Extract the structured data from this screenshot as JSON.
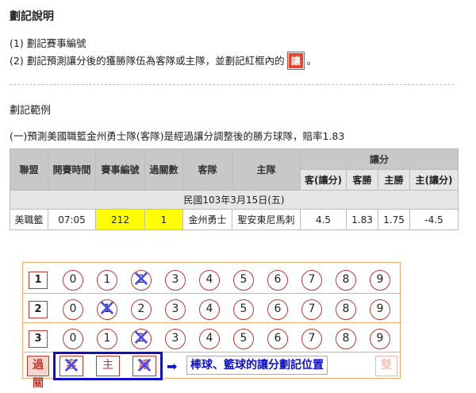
{
  "heading": "劃記說明",
  "instructions": {
    "item1": "(1) 劃記賽事編號",
    "item2_before": "(2) 劃記預測讓分後的獲勝隊伍為客隊或主隊，並劃記紅框內的",
    "item2_mark": "讓",
    "item2_after": "。"
  },
  "example": {
    "title": "劃記範例",
    "description": "(一)預測美國職籃金州勇士隊(客隊)是經過讓分調整後的勝方球隊，賠率1.83"
  },
  "table": {
    "headers": {
      "league": "聯盟",
      "time": "開賽時間",
      "event_no": "賽事編號",
      "passes": "過關數",
      "away": "客隊",
      "home": "主隊",
      "handicap": "讓分"
    },
    "sub_headers": [
      "客(讓分)",
      "客勝",
      "主勝",
      "主(讓分)"
    ],
    "date_row": "民國103年3月15日(五)",
    "row": {
      "league": "美職籃",
      "time": "07:05",
      "event_no": "212",
      "passes": "1",
      "away": "金州勇士",
      "home": "聖安東尼馬刺",
      "away_handicap": "4.5",
      "away_win": "1.83",
      "home_win": "1.75",
      "home_handicap": "-4.5"
    }
  },
  "card": {
    "rows": [
      {
        "label": "1",
        "digits": [
          "0",
          "1",
          "2",
          "3",
          "4",
          "5",
          "6",
          "7",
          "8",
          "9"
        ],
        "marked": 2
      },
      {
        "label": "2",
        "digits": [
          "0",
          "1",
          "2",
          "3",
          "4",
          "5",
          "6",
          "7",
          "8",
          "9"
        ],
        "marked": 1
      },
      {
        "label": "3",
        "digits": [
          "0",
          "1",
          "2",
          "3",
          "4",
          "5",
          "6",
          "7",
          "8",
          "9"
        ],
        "marked": 2
      }
    ],
    "pass_label": "過關",
    "away_label": "客",
    "home_label": "主",
    "handicap_label": "讓",
    "arrow_text": "棒球、籃球的讓分劃記位置",
    "double_label": "雙",
    "colors": {
      "mark": "#4b4bf0",
      "frame": "#1010c8",
      "accent": "#c0392b"
    }
  }
}
